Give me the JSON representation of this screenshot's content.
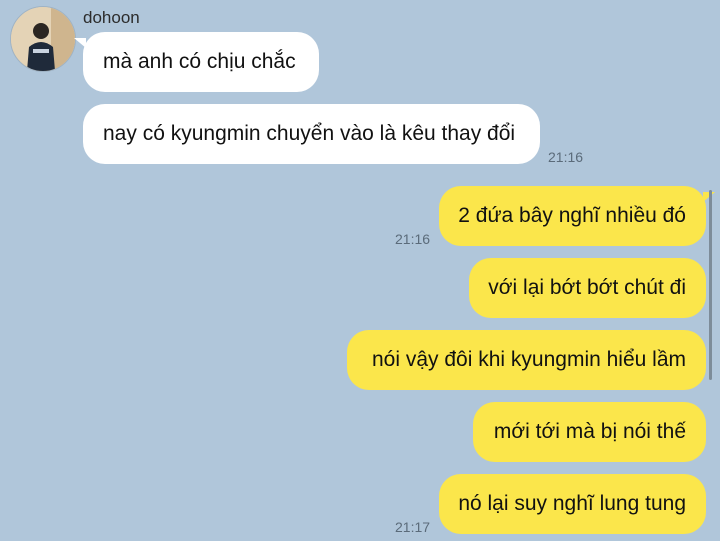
{
  "chat": {
    "contact_name": "dohoon",
    "messages": [
      {
        "text": "mà anh có chịu chắc",
        "from": "incoming"
      },
      {
        "text": "nay có kyungmin chuyển vào là kêu thay đổi",
        "from": "incoming",
        "time": "21:16"
      },
      {
        "text": "2 đứa bây nghĩ nhiều đó",
        "from": "outgoing",
        "time": "21:16"
      },
      {
        "text": "với lại bớt bớt chút đi",
        "from": "outgoing"
      },
      {
        "text": "nói vậy đôi khi kyungmin hiểu lầm",
        "from": "outgoing"
      },
      {
        "text": "mới tới mà bị nói thế",
        "from": "outgoing"
      },
      {
        "text": "nó lại suy nghĩ lung tung",
        "from": "outgoing",
        "time": "21:17"
      }
    ]
  },
  "colors": {
    "background": "#b0c6da",
    "incoming_bubble": "#ffffff",
    "outgoing_bubble": "#fbe64b"
  }
}
